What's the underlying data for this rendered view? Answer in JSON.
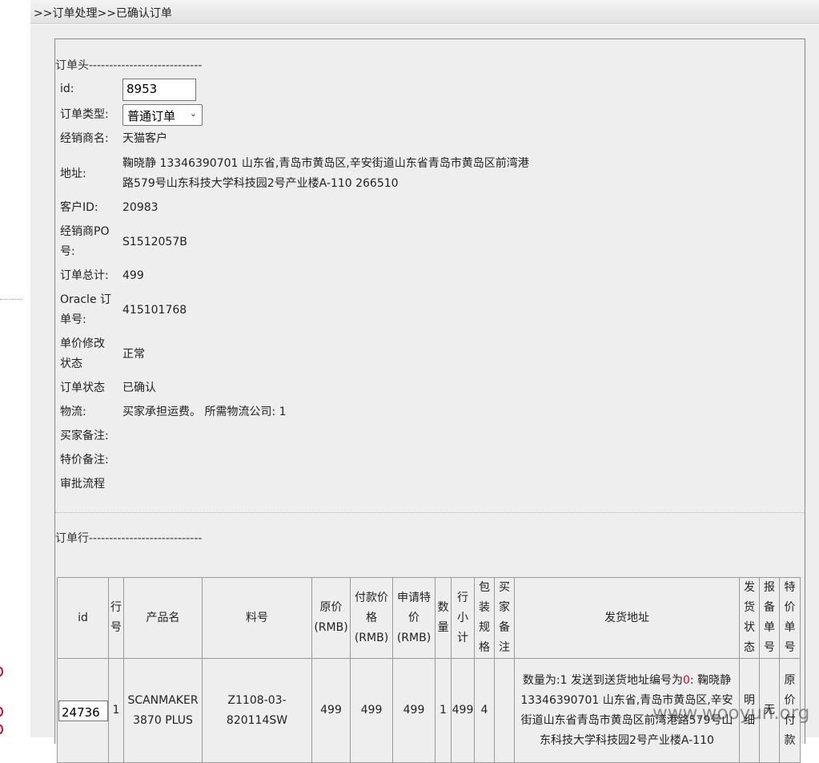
{
  "breadcrumb": ">>订单处理>>已确认订单",
  "header_section": {
    "title": "订单头----------------------------",
    "id_label": "id:",
    "id_value": "8953",
    "order_type_label": "订单类型:",
    "order_type_value": "普通订单",
    "dealer_name_label": "经销商名:",
    "dealer_name_value": "天猫客户",
    "address_label": "地址:",
    "address_line1": "鞠晓静 13346390701 山东省,青岛市黄岛区,辛安街道山东省青岛市黄岛区前湾港",
    "address_line2": "路579号山东科技大学科技园2号产业楼A-110 266510",
    "customer_id_label": "客户ID:",
    "customer_id_value": "20983",
    "dealer_po_label_1": "经销商PO",
    "dealer_po_label_2": "号:",
    "dealer_po_value": "S1512057B",
    "order_total_label": "订单总计:",
    "order_total_value": "499",
    "oracle_label_1": "Oracle 订",
    "oracle_label_2": "单号:",
    "oracle_value": "415101768",
    "price_mod_label_1": "单价修改",
    "price_mod_label_2": "状态",
    "price_mod_value": "正常",
    "order_status_label": "订单状态",
    "order_status_value": "已确认",
    "logistics_label": "物流:",
    "logistics_value": "买家承担运费。 所需物流公司: 1",
    "buyer_note_label": "买家备注:",
    "special_note_label": "特价备注:",
    "approval_label": "审批流程"
  },
  "lines_section": {
    "title": "订单行----------------------------",
    "headers": {
      "id": "id",
      "line_no_1": "行",
      "line_no_2": "号",
      "product": "产品名",
      "part_no": "料号",
      "orig_price_1": "原价",
      "orig_price_2": "(RMB)",
      "pay_price_1": "付款价",
      "pay_price_2": "格",
      "pay_price_3": "(RMB)",
      "req_price_1": "申请特",
      "req_price_2": "价",
      "req_price_3": "(RMB)",
      "qty_1": "数",
      "qty_2": "量",
      "subtotal_1": "行",
      "subtotal_2": "小",
      "subtotal_3": "计",
      "pack_1": "包",
      "pack_2": "装",
      "pack_3": "规",
      "pack_4": "格",
      "buyer_note_1": "买",
      "buyer_note_2": "家",
      "buyer_note_3": "备",
      "buyer_note_4": "注",
      "ship_addr": "发货地址",
      "ship_status_1": "发",
      "ship_status_2": "货",
      "ship_status_3": "状",
      "ship_status_4": "态",
      "report_no_1": "报",
      "report_no_2": "备",
      "report_no_3": "单",
      "report_no_4": "号",
      "special_no_1": "特",
      "special_no_2": "价",
      "special_no_3": "单",
      "special_no_4": "号"
    },
    "rows": [
      {
        "id": "24736",
        "line_no": "1",
        "product_1": "SCANMAKER",
        "product_2": "3870 PLUS",
        "part_no": "Z1108-03-820114SW",
        "orig_price": "499",
        "pay_price": "499",
        "req_price": "499",
        "qty": "1",
        "subtotal": "499",
        "pack": "4",
        "buyer_note": "",
        "addr_prefix": "数量为:1 发送到送货地址编号为",
        "addr_code": "0",
        "addr_after": ": 鞠晓静",
        "addr_line2": "13346390701 山东省,青岛市黄岛区,辛安",
        "addr_line3": "街道山东省青岛市黄岛区前湾港路579号山",
        "addr_line4": "东科技大学科技园2号产业楼A-110",
        "ship_status_1": "明",
        "ship_status_2": "细",
        "report_no": "无",
        "special_1": "原",
        "special_2": "价",
        "special_3": "付",
        "special_4": "款"
      }
    ]
  },
  "watermark": "www.wooyun.org",
  "colors": {
    "accent_red": "#e4001b",
    "panel_bg": "#eeeeee",
    "border": "#8a8a8a"
  }
}
